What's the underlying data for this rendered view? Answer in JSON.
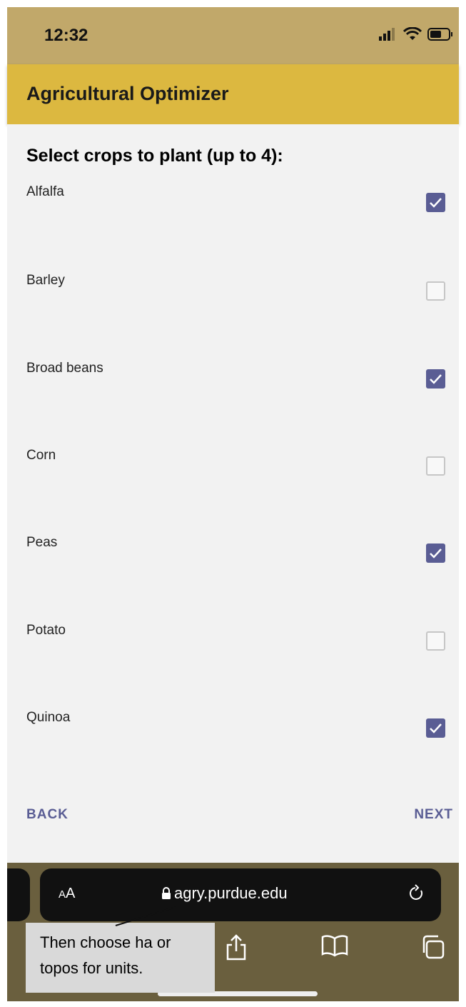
{
  "status_bar": {
    "time": "12:32"
  },
  "app": {
    "title": "Agricultural Optimizer"
  },
  "content": {
    "heading": "Select crops to plant (up to 4):",
    "crops": [
      {
        "label": "Alfalfa",
        "checked": true
      },
      {
        "label": "Barley",
        "checked": false
      },
      {
        "label": "Broad beans",
        "checked": true
      },
      {
        "label": "Corn",
        "checked": false
      },
      {
        "label": "Peas",
        "checked": true
      },
      {
        "label": "Potato",
        "checked": false
      },
      {
        "label": "Quinoa",
        "checked": true
      }
    ],
    "back_label": "BACK",
    "next_label": "NEXT"
  },
  "browser": {
    "aa_small": "A",
    "aa_large": "A",
    "url": "agry.purdue.edu"
  },
  "tooltip": {
    "line1": "Then choose ha or",
    "line2": "topos for units."
  },
  "colors": {
    "status_bar": "#c1a86a",
    "app_bar": "#dcb840",
    "accent": "#5a5d94",
    "content_bg": "#f2f2f2",
    "browser_bg": "#6a5f3e"
  }
}
